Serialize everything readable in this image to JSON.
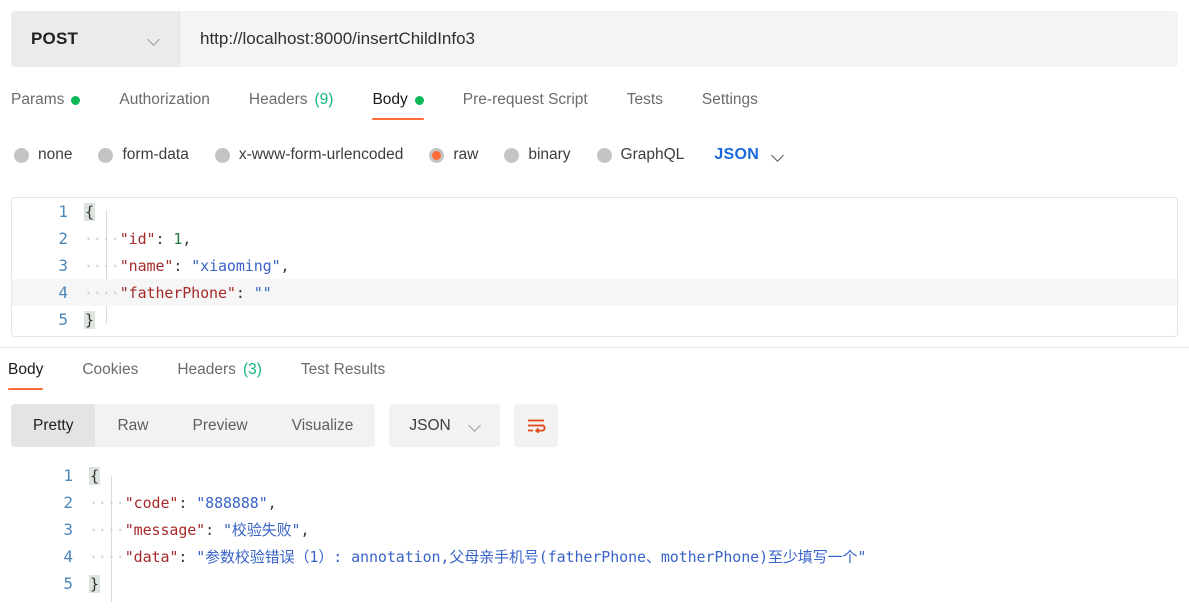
{
  "request_bar": {
    "method": "POST",
    "method_icon": "chevron-down-icon",
    "url": "http://localhost:8000/insertChildInfo3",
    "url_placeholder": "Enter request URL"
  },
  "request_tabs": [
    {
      "label": "Params",
      "badge": "",
      "dot": true,
      "active": false
    },
    {
      "label": "Authorization",
      "badge": "",
      "dot": false,
      "active": false
    },
    {
      "label": "Headers",
      "badge": "(9)",
      "dot": false,
      "active": false
    },
    {
      "label": "Body",
      "badge": "",
      "dot": true,
      "active": true
    },
    {
      "label": "Pre-request Script",
      "badge": "",
      "dot": false,
      "active": false
    },
    {
      "label": "Tests",
      "badge": "",
      "dot": false,
      "active": false
    },
    {
      "label": "Settings",
      "badge": "",
      "dot": false,
      "active": false
    }
  ],
  "body_types": {
    "options": [
      {
        "label": "none",
        "selected": false
      },
      {
        "label": "form-data",
        "selected": false
      },
      {
        "label": "x-www-form-urlencoded",
        "selected": false
      },
      {
        "label": "raw",
        "selected": true
      },
      {
        "label": "binary",
        "selected": false
      },
      {
        "label": "GraphQL",
        "selected": false
      }
    ],
    "format": "JSON",
    "format_icon": "chevron-down-icon"
  },
  "request_body": {
    "lines": [
      {
        "n": "1",
        "tokens": [
          {
            "t": "{",
            "c": "brace"
          }
        ],
        "highlight": false
      },
      {
        "n": "2",
        "tokens": [
          {
            "t": "    ",
            "c": "ind"
          },
          {
            "t": "\"id\"",
            "c": "key"
          },
          {
            "t": ": ",
            "c": "pun"
          },
          {
            "t": "1",
            "c": "num"
          },
          {
            "t": ",",
            "c": "pun"
          }
        ],
        "highlight": false
      },
      {
        "n": "3",
        "tokens": [
          {
            "t": "    ",
            "c": "ind"
          },
          {
            "t": "\"name\"",
            "c": "key"
          },
          {
            "t": ": ",
            "c": "pun"
          },
          {
            "t": "\"xiaoming\"",
            "c": "str"
          },
          {
            "t": ",",
            "c": "pun"
          }
        ],
        "highlight": false
      },
      {
        "n": "4",
        "tokens": [
          {
            "t": "    ",
            "c": "ind"
          },
          {
            "t": "\"fatherPhone\"",
            "c": "key"
          },
          {
            "t": ": ",
            "c": "pun"
          },
          {
            "t": "\"\"",
            "c": "str"
          }
        ],
        "highlight": true
      },
      {
        "n": "5",
        "tokens": [
          {
            "t": "}",
            "c": "brace"
          }
        ],
        "highlight": false
      }
    ]
  },
  "response_tabs": [
    {
      "label": "Body",
      "badge": "",
      "active": true
    },
    {
      "label": "Cookies",
      "badge": "",
      "active": false
    },
    {
      "label": "Headers",
      "badge": "(3)",
      "active": false
    },
    {
      "label": "Test Results",
      "badge": "",
      "active": false
    }
  ],
  "response_toolbar": {
    "views": [
      {
        "label": "Pretty",
        "active": true
      },
      {
        "label": "Raw",
        "active": false
      },
      {
        "label": "Preview",
        "active": false
      },
      {
        "label": "Visualize",
        "active": false
      }
    ],
    "format": "JSON",
    "format_icon": "chevron-down-icon",
    "wrap_icon": "wrap-lines-icon"
  },
  "response_body": {
    "lines": [
      {
        "n": "1",
        "tokens": [
          {
            "t": "{",
            "c": "brace"
          }
        ]
      },
      {
        "n": "2",
        "tokens": [
          {
            "t": "    ",
            "c": "ind"
          },
          {
            "t": "\"code\"",
            "c": "key"
          },
          {
            "t": ": ",
            "c": "pun"
          },
          {
            "t": "\"888888\"",
            "c": "str"
          },
          {
            "t": ",",
            "c": "pun"
          }
        ]
      },
      {
        "n": "3",
        "tokens": [
          {
            "t": "    ",
            "c": "ind"
          },
          {
            "t": "\"message\"",
            "c": "key"
          },
          {
            "t": ": ",
            "c": "pun"
          },
          {
            "t": "\"校验失败\"",
            "c": "str"
          },
          {
            "t": ",",
            "c": "pun"
          }
        ]
      },
      {
        "n": "4",
        "tokens": [
          {
            "t": "    ",
            "c": "ind"
          },
          {
            "t": "\"data\"",
            "c": "key"
          },
          {
            "t": ": ",
            "c": "pun"
          },
          {
            "t": "\"参数校验错误（1）: annotation,父母亲手机号(fatherPhone、motherPhone)至少填写一个\"",
            "c": "str"
          }
        ]
      },
      {
        "n": "5",
        "tokens": [
          {
            "t": "}",
            "c": "brace"
          }
        ]
      }
    ]
  },
  "colors": {
    "accent": "#ff6c37",
    "dot_green": "#0fb857",
    "count_green": "#10b77f",
    "json_blue": "#1668dc",
    "key_red": "#a52a2a",
    "string_blue": "#3a63c8",
    "number_green": "#1f7a3d",
    "line_number": "#4d86b8"
  }
}
